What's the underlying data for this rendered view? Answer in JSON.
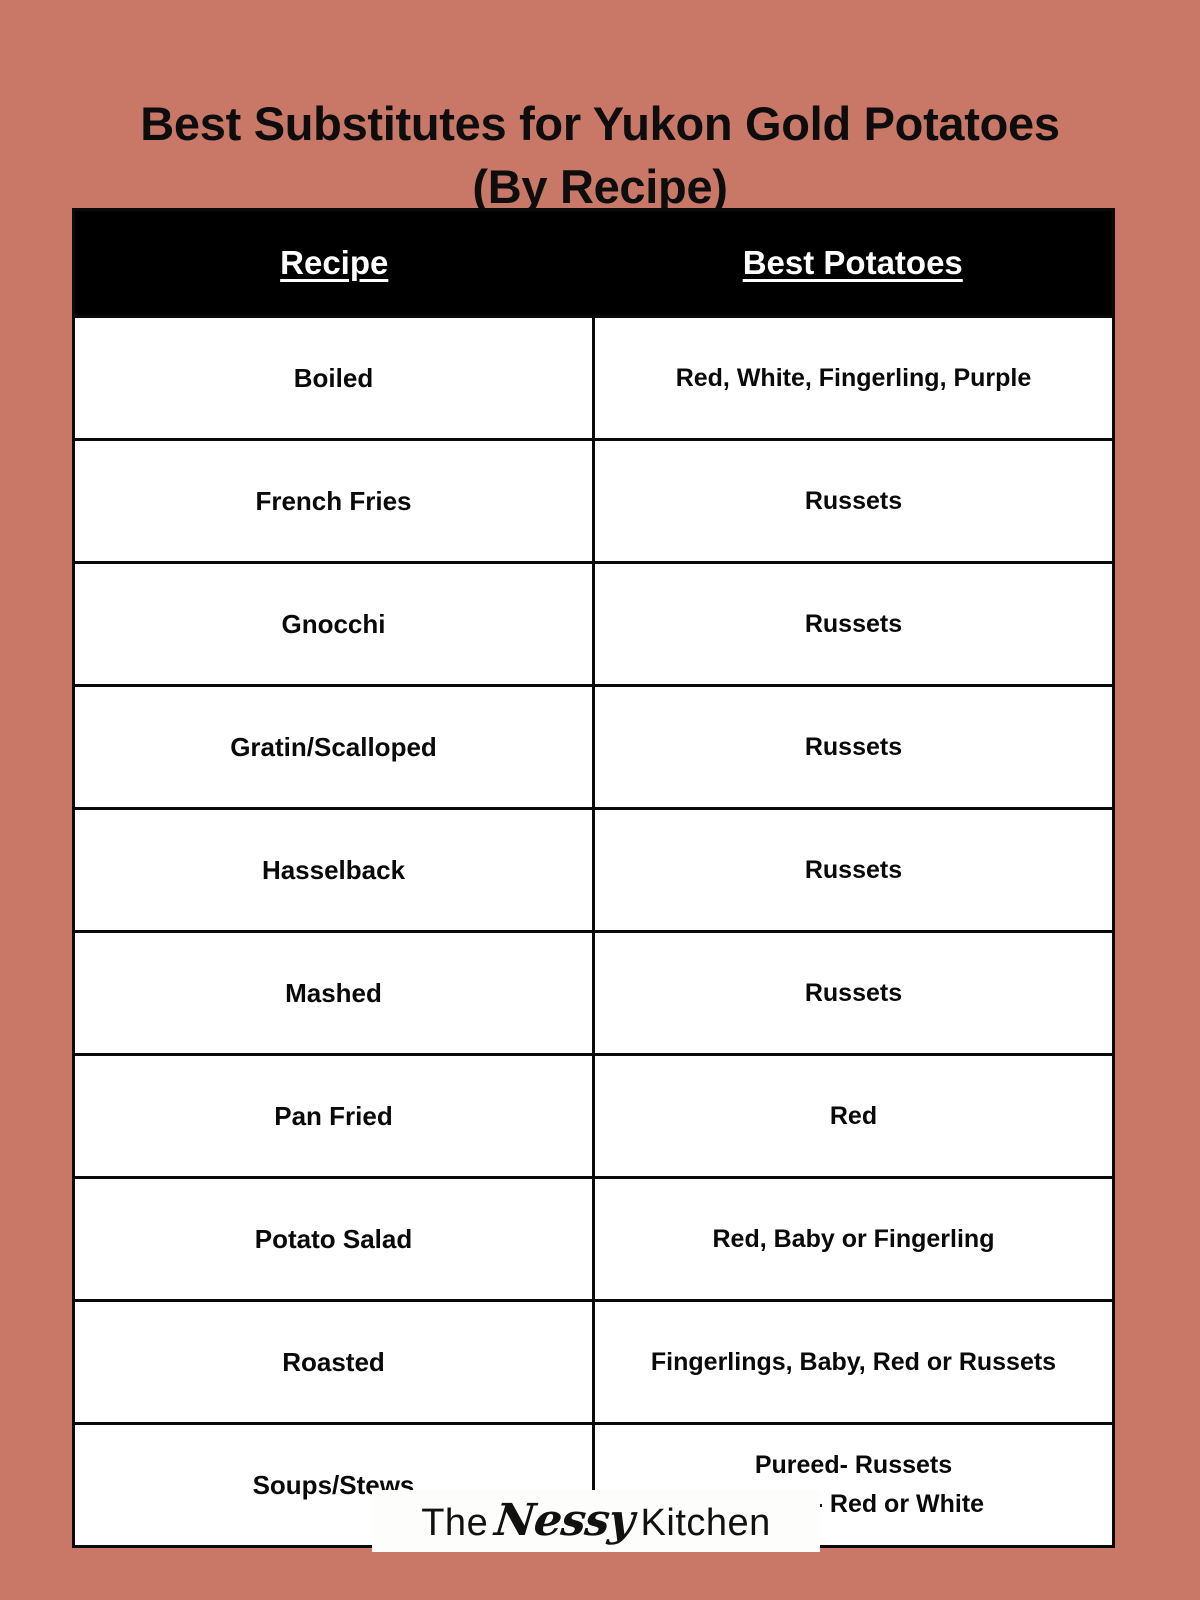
{
  "theme": {
    "background_color": "#c97766",
    "table_border_color": "#0a0a0a",
    "header_background": "#000000",
    "header_text_color": "#ffffff",
    "cell_background": "#ffffff",
    "cell_text_color": "#0a0a0a"
  },
  "title": {
    "line1": "Best Substitutes for Yukon Gold Potatoes",
    "line2": "(By Recipe)"
  },
  "table": {
    "columns": [
      {
        "key": "recipe",
        "label": "Recipe"
      },
      {
        "key": "best_potatoes",
        "label": "Best Potatoes"
      }
    ],
    "rows": [
      {
        "recipe": "Boiled",
        "best_potatoes": "Red, White, Fingerling, Purple"
      },
      {
        "recipe": "French Fries",
        "best_potatoes": "Russets"
      },
      {
        "recipe": "Gnocchi",
        "best_potatoes": "Russets"
      },
      {
        "recipe": "Gratin/Scalloped",
        "best_potatoes": "Russets"
      },
      {
        "recipe": "Hasselback",
        "best_potatoes": "Russets"
      },
      {
        "recipe": "Mashed",
        "best_potatoes": "Russets"
      },
      {
        "recipe": "Pan Fried",
        "best_potatoes": "Red"
      },
      {
        "recipe": "Potato Salad",
        "best_potatoes": "Red, Baby or Fingerling"
      },
      {
        "recipe": "Roasted",
        "best_potatoes": "Fingerlings, Baby, Red or Russets"
      },
      {
        "recipe": "Soups/Stews",
        "best_potatoes": "Pureed- Russets\nChunky- Red or White"
      }
    ]
  },
  "logo": {
    "word1": "The",
    "word2": "Nessy",
    "word3": "Kitchen",
    "full_text": "The Nessy Kitchen"
  }
}
